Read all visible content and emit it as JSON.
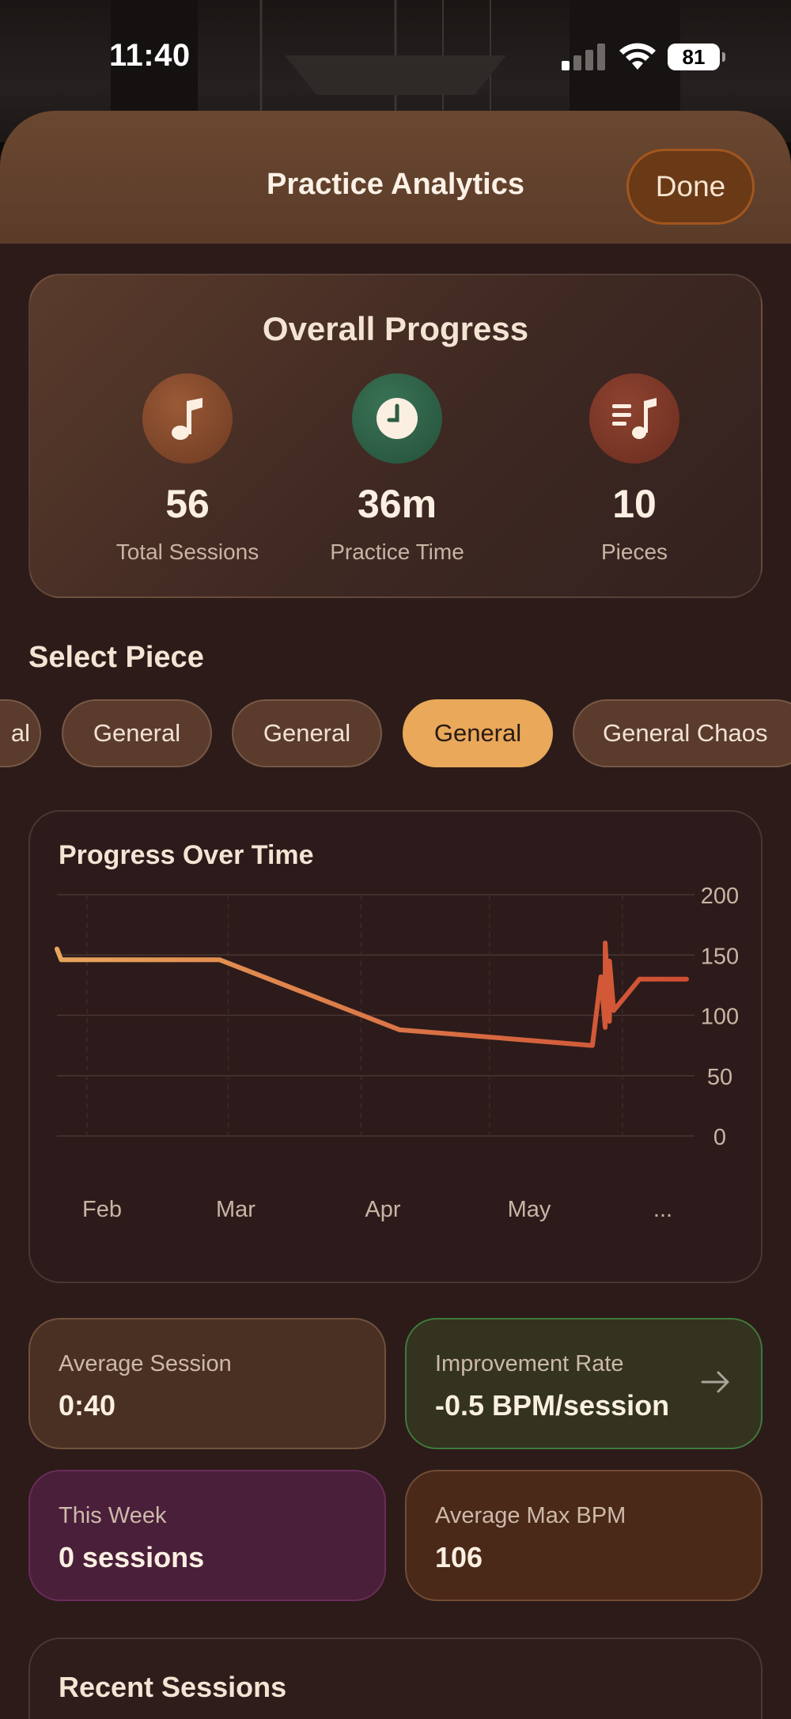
{
  "status_bar": {
    "time": "11:40",
    "battery": "81"
  },
  "header": {
    "title": "Practice Analytics",
    "done_label": "Done"
  },
  "overall": {
    "title": "Overall Progress",
    "stats": [
      {
        "value": "56",
        "label": "Total Sessions",
        "icon": "music-note-icon",
        "color": "#8a4a2a"
      },
      {
        "value": "36m",
        "label": "Practice Time",
        "icon": "clock-icon",
        "color": "#2e5d44"
      },
      {
        "value": "10",
        "label": "Pieces",
        "icon": "music-list-icon",
        "color": "#7a3524"
      }
    ]
  },
  "select_piece": {
    "title": "Select Piece",
    "chips": [
      "al",
      "General",
      "General",
      "General",
      "General Chaos"
    ],
    "active_index": 3
  },
  "chart_data": {
    "type": "line",
    "title": "Progress Over Time",
    "x_tick_labels": [
      "Feb",
      "Mar",
      "Apr",
      "May",
      "..."
    ],
    "y_tick_labels": [
      "200",
      "150",
      "100",
      "50",
      "0"
    ],
    "ylim": [
      0,
      200
    ],
    "grid": true,
    "series": [
      {
        "color_start": "#e8a55c",
        "color_end": "#cf4d33",
        "points": [
          {
            "x": "Jan 21",
            "y": 155
          },
          {
            "x": "Jan 22",
            "y": 146
          },
          {
            "x": "Feb 28",
            "y": 146
          },
          {
            "x": "Apr 10",
            "y": 88
          },
          {
            "x": "May 25",
            "y": 75
          },
          {
            "x": "May 27",
            "y": 132
          },
          {
            "x": "May 28",
            "y": 90
          },
          {
            "x": "May 28",
            "y": 160
          },
          {
            "x": "May 29",
            "y": 95
          },
          {
            "x": "May 29",
            "y": 145
          },
          {
            "x": "May 30",
            "y": 104
          },
          {
            "x": "Jun 5",
            "y": 130
          },
          {
            "x": "Jun 16",
            "y": 130
          }
        ]
      }
    ]
  },
  "metrics": {
    "average_session": {
      "label": "Average Session",
      "value": "0:40"
    },
    "improvement_rate": {
      "label": "Improvement Rate",
      "value": "-0.5 BPM/session"
    },
    "this_week": {
      "label": "This Week",
      "value": "0 sessions"
    },
    "average_max_bpm": {
      "label": "Average Max BPM",
      "value": "106"
    }
  },
  "recent": {
    "title": "Recent Sessions"
  }
}
